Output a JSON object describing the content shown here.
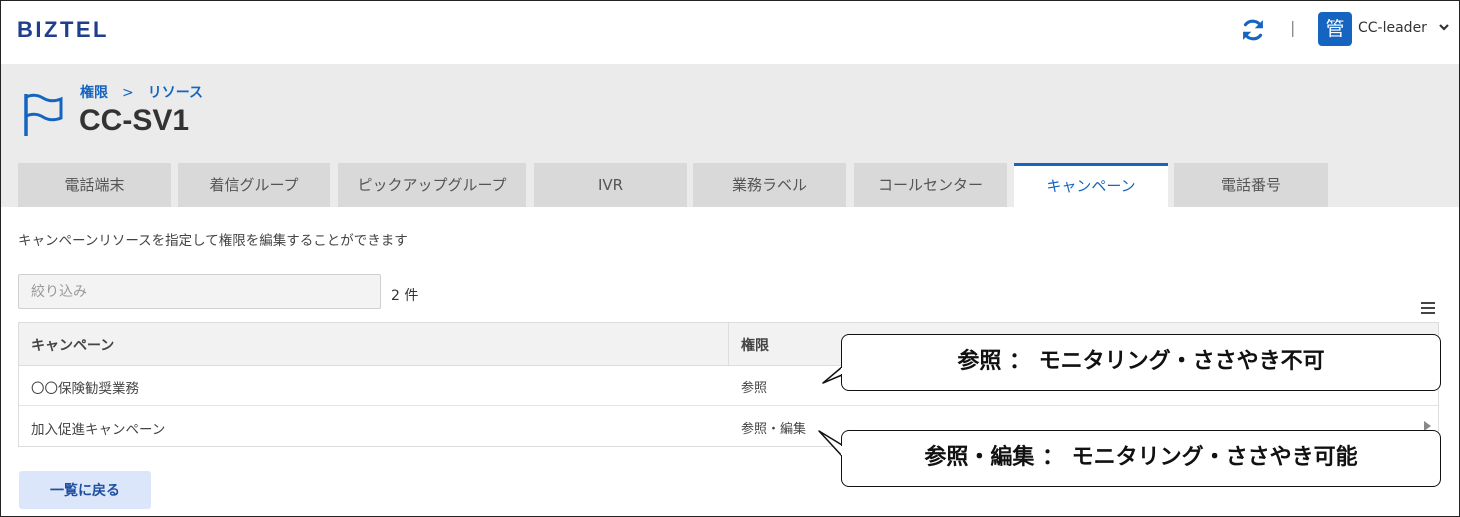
{
  "app": {
    "logo": "BIZTEL"
  },
  "topbar": {
    "separator": "|",
    "avatar_char": "管",
    "username": "CC-leader"
  },
  "breadcrumb": {
    "root": "権限",
    "separator": ">",
    "current": "リソース"
  },
  "page": {
    "title": "CC-SV1"
  },
  "tabs": [
    {
      "label": "電話端末",
      "active": false
    },
    {
      "label": "着信グループ",
      "active": false
    },
    {
      "label": "ピックアップグループ",
      "active": false
    },
    {
      "label": "IVR",
      "active": false
    },
    {
      "label": "業務ラベル",
      "active": false
    },
    {
      "label": "コールセンター",
      "active": false
    },
    {
      "label": "キャンペーン",
      "active": true
    },
    {
      "label": "電話番号",
      "active": false
    }
  ],
  "description": "キャンペーンリソースを指定して権限を編集することができます",
  "filter": {
    "placeholder": "絞り込み",
    "value": ""
  },
  "count": "2 件",
  "table": {
    "headers": {
      "campaign": "キャンペーン",
      "permission": "権限"
    },
    "rows": [
      {
        "campaign": "〇〇保険勧奨業務",
        "permission": "参照"
      },
      {
        "campaign": "加入促進キャンペーン",
        "permission": "参照・編集"
      }
    ]
  },
  "back_button": "一覧に戻る",
  "callouts": [
    "参照 ： モニタリング・ささやき不可",
    "参照・編集 ： モニタリング・ささやき可能"
  ],
  "colors": {
    "accent": "#1565c0",
    "logo": "#1f3e8c",
    "header_band": "#ebebeb",
    "tab_inactive": "#d9d9d9"
  },
  "icons": {
    "reload": "reload-icon",
    "user_menu": "chevron-down-icon",
    "page": "flag-icon",
    "list_menu": "hamburger-menu-icon",
    "row_expand": "triangle-right-icon"
  }
}
